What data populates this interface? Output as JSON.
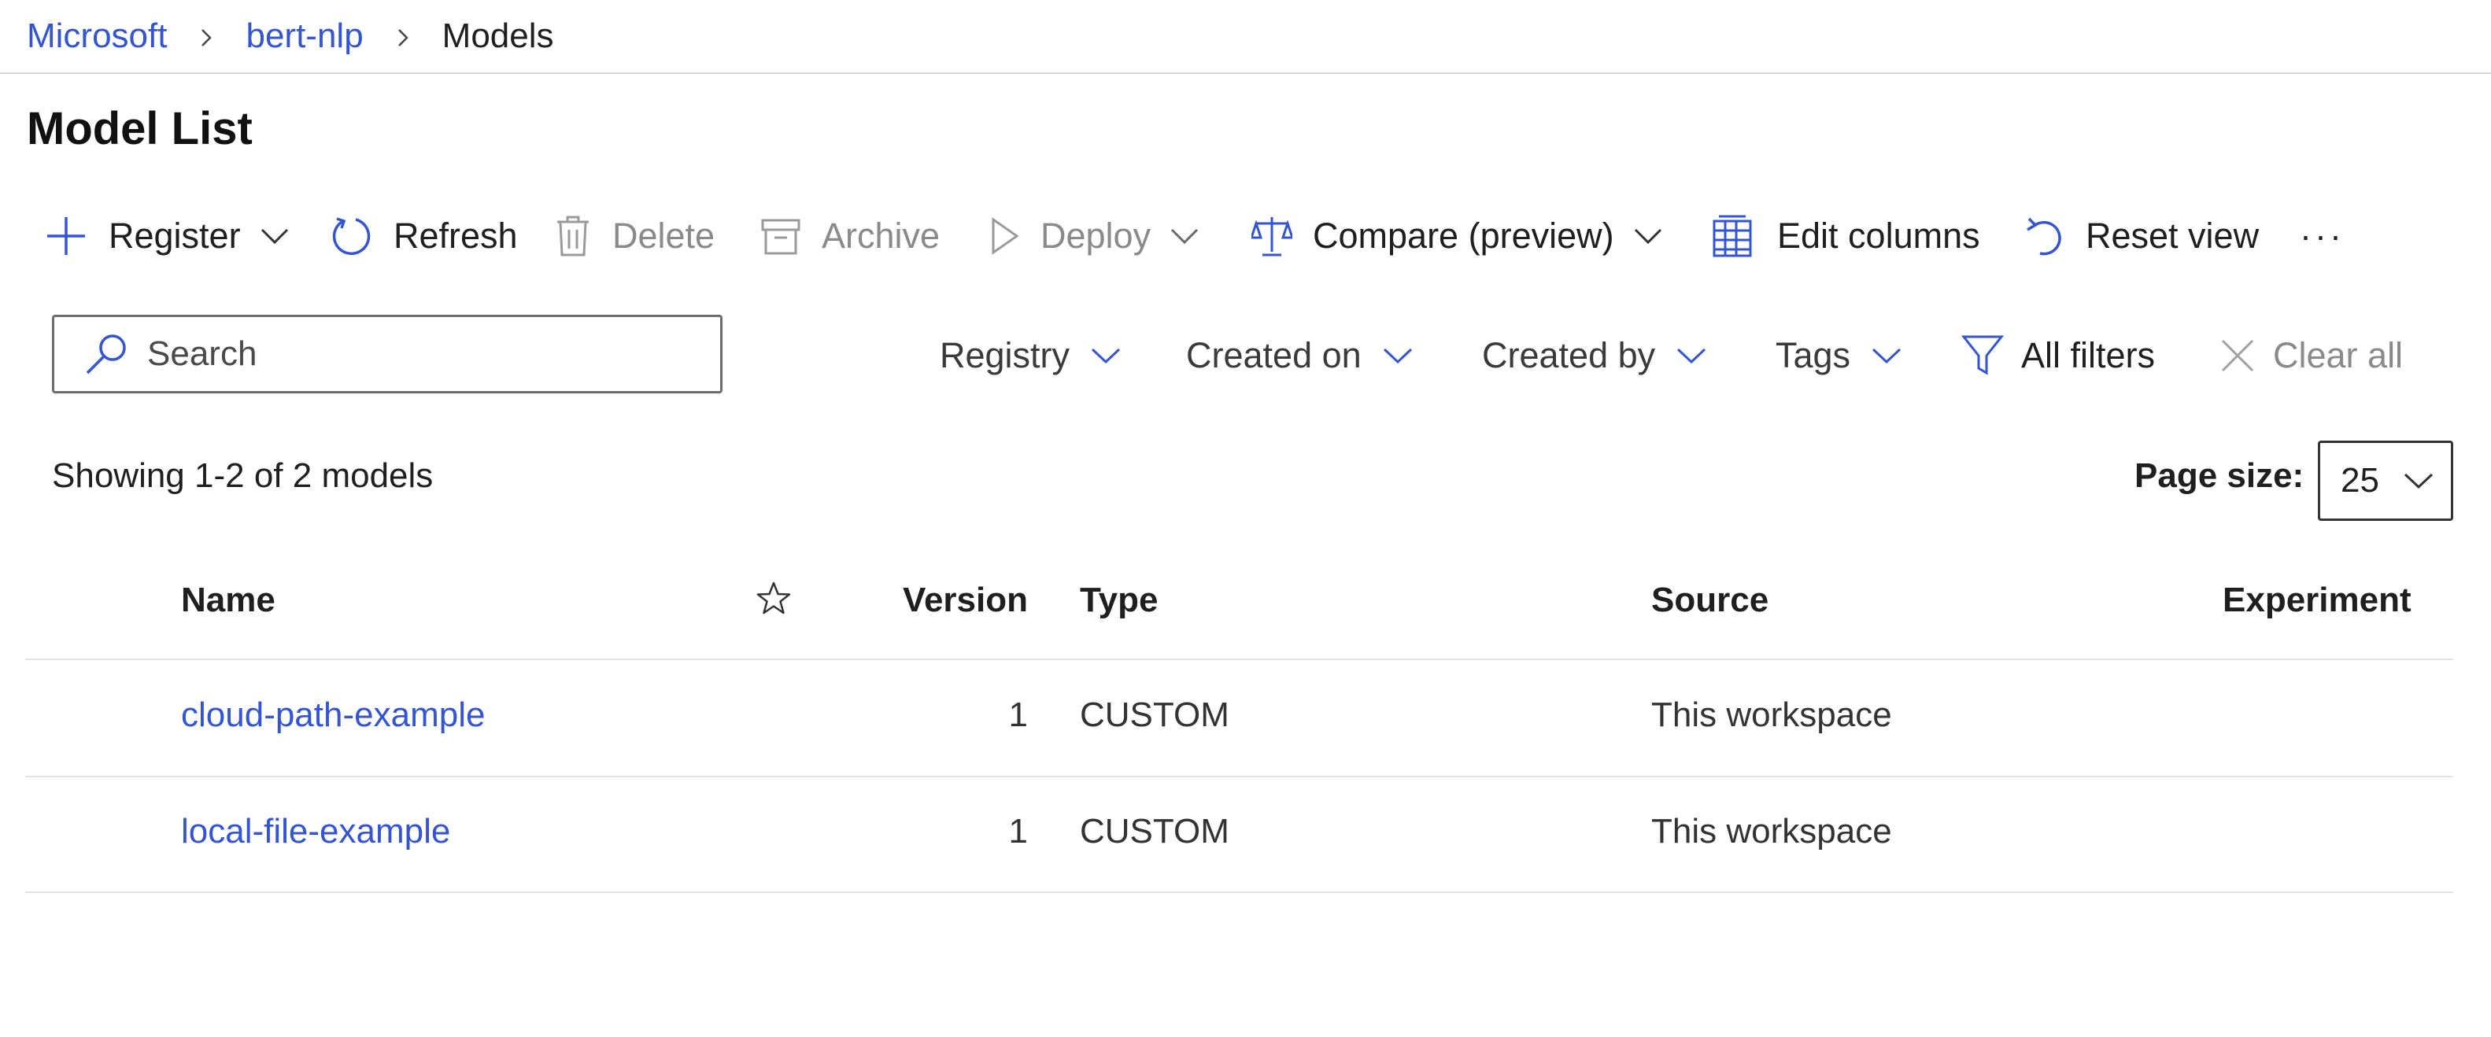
{
  "breadcrumb": {
    "org": "Microsoft",
    "workspace": "bert-nlp",
    "current": "Models"
  },
  "page": {
    "title": "Model List"
  },
  "toolbar": {
    "register": "Register",
    "refresh": "Refresh",
    "delete": "Delete",
    "archive": "Archive",
    "deploy": "Deploy",
    "compare": "Compare (preview)",
    "edit_columns": "Edit columns",
    "reset_view": "Reset view",
    "more": "···"
  },
  "search": {
    "placeholder": "Search",
    "value": ""
  },
  "filters": {
    "registry": "Registry",
    "created_on": "Created on",
    "created_by": "Created by",
    "tags": "Tags",
    "all_filters": "All filters",
    "clear_all": "Clear all"
  },
  "summary": {
    "showing": "Showing 1-2 of 2 models"
  },
  "page_size": {
    "label": "Page size:",
    "value": "25"
  },
  "table": {
    "headers": {
      "name": "Name",
      "version": "Version",
      "type": "Type",
      "source": "Source",
      "experiment": "Experiment"
    },
    "rows": [
      {
        "name": "cloud-path-example",
        "version": "1",
        "type": "CUSTOM",
        "source": "This workspace",
        "experiment": ""
      },
      {
        "name": "local-file-example",
        "version": "1",
        "type": "CUSTOM",
        "source": "This workspace",
        "experiment": ""
      }
    ]
  },
  "colors": {
    "accent": "#3454d1",
    "text": "#1f1f1f",
    "disabled": "#8a8a8a",
    "divider": "#d6d6d6"
  },
  "icons": [
    "chevron-right-icon",
    "plus-icon",
    "refresh-icon",
    "trash-icon",
    "archive-icon",
    "play-icon",
    "scales-icon",
    "table-columns-icon",
    "undo-icon",
    "more-icon",
    "search-icon",
    "filter-icon",
    "close-icon",
    "chevron-down-icon",
    "star-icon"
  ]
}
